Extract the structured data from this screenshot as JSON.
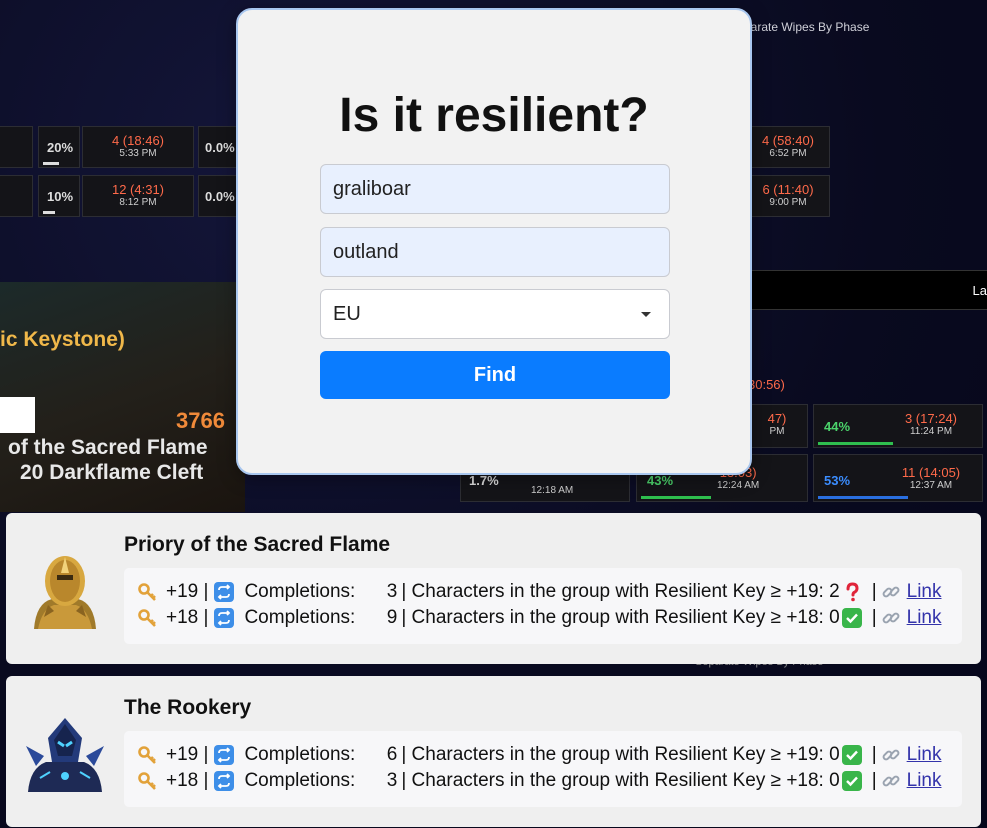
{
  "background": {
    "top_right_label": "parate Wipes By Phase",
    "keystone_text": "ic Keystone)",
    "score": "3766",
    "dungeon_line_1": "of the Sacred Flame",
    "dungeon_line_2": "20 Darkflame Cleft",
    "right_strip_text": "La",
    "stats": [
      {
        "pct": "20%",
        "main": "4 (18:46)",
        "sub": "5:33 PM"
      },
      {
        "pct": "10%",
        "main": "12 (4:31)",
        "sub": "8:12 PM"
      },
      {
        "pct": "0.0%"
      },
      {
        "pct": "0.0%"
      },
      {
        "main": "4 (58:40)",
        "sub": "6:52 PM"
      },
      {
        "main": "6 (11:40)",
        "sub": "9:00 PM"
      },
      {
        "pct": "44%",
        "main": "3 (17:24)",
        "sub": "11:24 PM"
      },
      {
        "pct": "53%",
        "main": "11 (14:05)",
        "sub": "12:37 AM"
      },
      {
        "pct": "1.7%",
        "sub": "12:18 AM"
      },
      {
        "pct": "43%",
        "main": "13:03)",
        "sub": "12:24 AM"
      },
      {
        "main": "47)",
        "sub": "PM"
      },
      {
        "main": "30:56)"
      }
    ],
    "bottom_label": "Separate Wipes By Phase"
  },
  "modal": {
    "title": "Is it resilient?",
    "character_value": "graliboar",
    "realm_value": "outland",
    "region_value": "EU",
    "find_label": "Find"
  },
  "results": [
    {
      "dungeon": "Priory of the Sacred Flame",
      "rows": [
        {
          "level": "+19 |",
          "completions_label": "Completions:",
          "count": "3",
          "chars_text": "| Characters in the group with Resilient Key ≥ +19: 2",
          "status": "question",
          "sep": "|",
          "link": "Link"
        },
        {
          "level": "+18 |",
          "completions_label": "Completions:",
          "count": "9",
          "chars_text": "| Characters in the group with Resilient Key ≥ +18: 0",
          "status": "check",
          "sep": "|",
          "link": "Link"
        }
      ]
    },
    {
      "dungeon": "The Rookery",
      "rows": [
        {
          "level": "+19 |",
          "completions_label": "Completions:",
          "count": "6",
          "chars_text": "| Characters in the group with Resilient Key ≥ +19: 0",
          "status": "check",
          "sep": "|",
          "link": "Link"
        },
        {
          "level": "+18 |",
          "completions_label": "Completions:",
          "count": "3",
          "chars_text": "| Characters in the group with Resilient Key ≥ +18: 0",
          "status": "check",
          "sep": "|",
          "link": "Link"
        }
      ]
    }
  ],
  "colors": {
    "accent": "#0a7cff",
    "check": "#39b54a",
    "question": "#e0243a",
    "repeat_icon": "#3d8ee8",
    "link": "#3333aa"
  }
}
